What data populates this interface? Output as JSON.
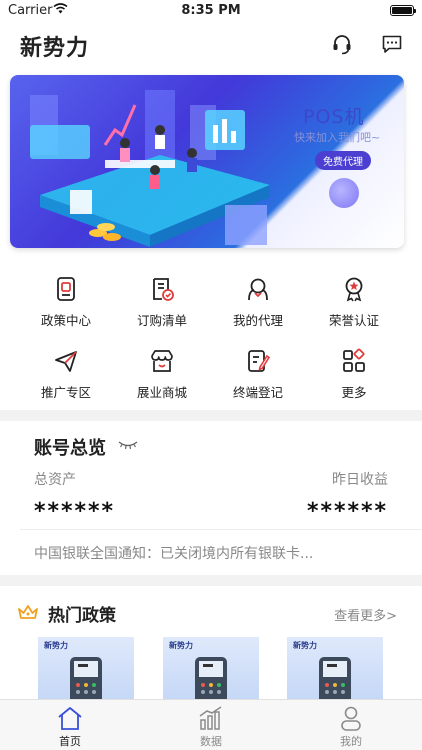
{
  "status_bar": {
    "carrier": "Carrier",
    "time": "8:35 PM"
  },
  "header": {
    "title": "新势力",
    "support_icon": "headset-icon",
    "message_icon": "chat-icon"
  },
  "banner": {
    "title": "POS机",
    "subtitle": "快来加入我们吧~",
    "button_label": "免费代理"
  },
  "menu": [
    {
      "label": "政策中心",
      "icon": "document-icon"
    },
    {
      "label": "订购清单",
      "icon": "order-list-icon"
    },
    {
      "label": "我的代理",
      "icon": "agent-icon"
    },
    {
      "label": "荣誉认证",
      "icon": "medal-icon"
    },
    {
      "label": "推广专区",
      "icon": "send-icon"
    },
    {
      "label": "展业商城",
      "icon": "shop-icon"
    },
    {
      "label": "终端登记",
      "icon": "register-icon"
    },
    {
      "label": "更多",
      "icon": "more-grid-icon"
    }
  ],
  "account": {
    "title": "账号总览",
    "total_assets_label": "总资产",
    "total_assets_value": "******",
    "yesterday_income_label": "昨日收益",
    "yesterday_income_value": "******",
    "notice": "中国银联全国通知：已关闭境内所有银联卡..."
  },
  "policy": {
    "title": "热门政策",
    "more_label": "查看更多>",
    "cards": [
      {
        "brand": "新势力"
      },
      {
        "brand": "新势力"
      },
      {
        "brand": "新势力"
      }
    ]
  },
  "tabs": [
    {
      "label": "首页",
      "icon": "home-icon",
      "active": true
    },
    {
      "label": "数据",
      "icon": "chart-icon",
      "active": false
    },
    {
      "label": "我的",
      "icon": "user-icon",
      "active": false
    }
  ],
  "colors": {
    "accent": "#4a3fd0",
    "banner_blue": "#4338d9",
    "crown": "#f0a020",
    "medal_red": "#e03c3c"
  }
}
